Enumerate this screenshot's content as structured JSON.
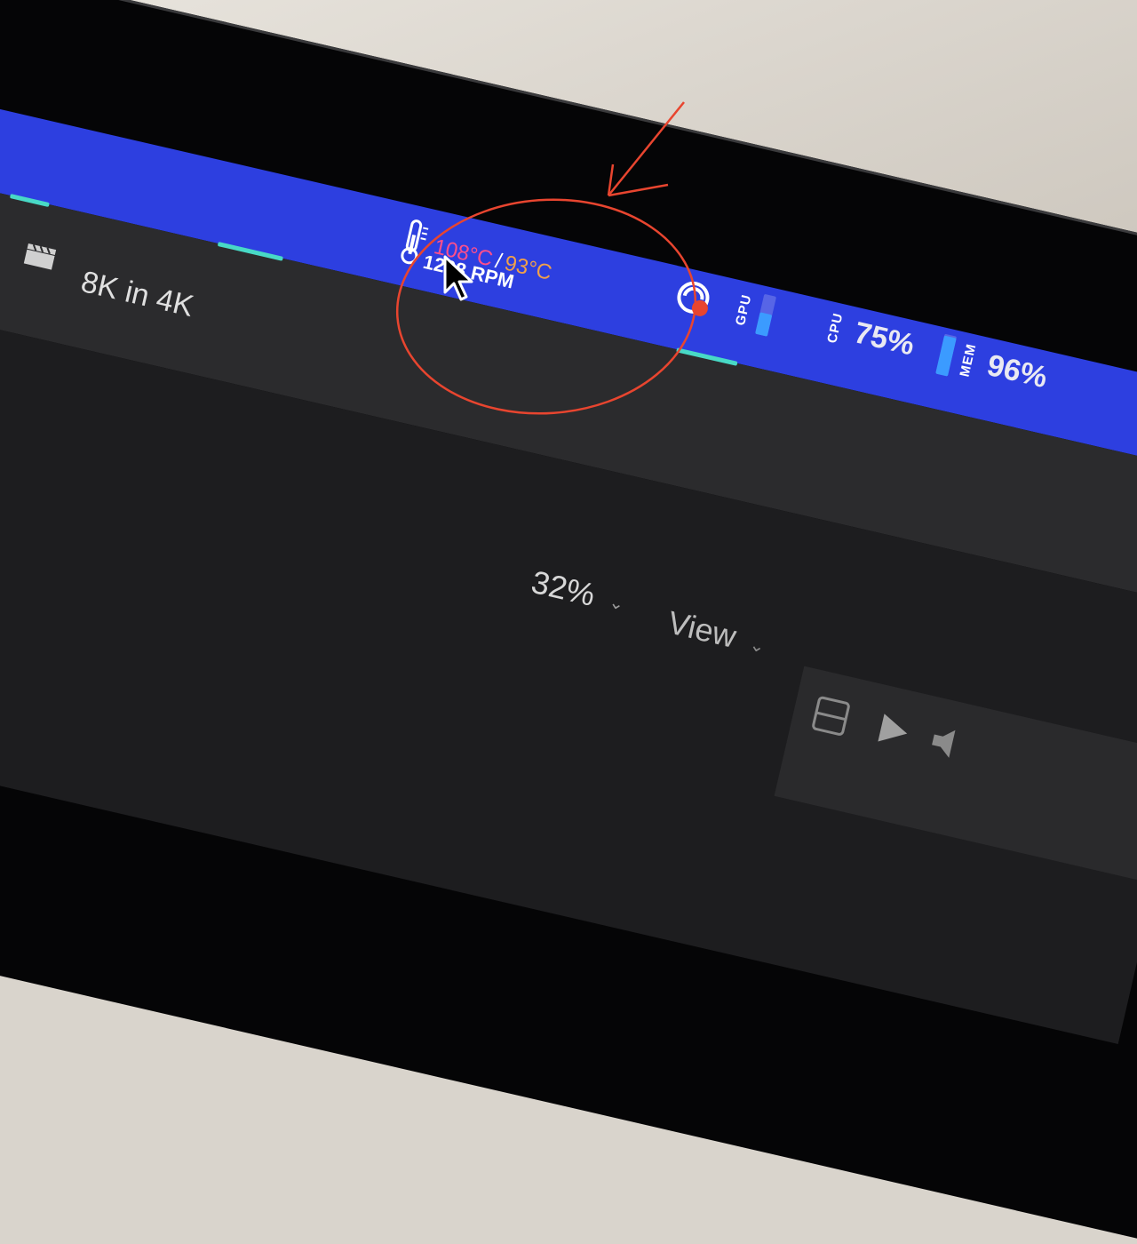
{
  "menu_bar": {
    "temperature": {
      "hot": "108°C",
      "separator": "/",
      "cool": "93°C"
    },
    "fan_speed": "1208 RPM",
    "gpu_label": "GPU",
    "gpu_level": 0.55,
    "cpu": {
      "label": "CPU",
      "percent": "75%"
    },
    "mem": {
      "label": "MEM",
      "percent": "96%",
      "level": 0.96
    }
  },
  "toolbar": {
    "project_title": "8K in 4K",
    "zoom": {
      "value": "32%",
      "chevron": "⌄"
    },
    "view_menu": {
      "label": "View",
      "chevron": "⌄"
    }
  },
  "annotation": {
    "color": "#e8452f"
  },
  "colors": {
    "menu_bar": "#2d3fe0",
    "temp_hot": "#ff4f8b",
    "temp_cool": "#f0a04b",
    "toolbar": "#2b2b2d"
  }
}
